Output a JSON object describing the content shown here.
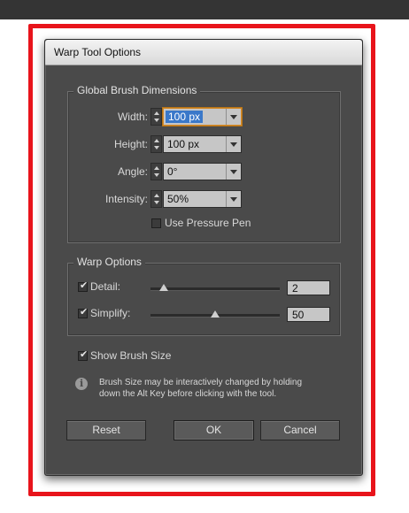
{
  "dialog": {
    "title": "Warp Tool Options"
  },
  "global_brush": {
    "legend": "Global Brush Dimensions",
    "fields": [
      {
        "label": "Width:",
        "value": "100 px",
        "focused": true
      },
      {
        "label": "Height:",
        "value": "100 px"
      },
      {
        "label": "Angle:",
        "value": "0°"
      },
      {
        "label": "Intensity:",
        "value": "50%"
      }
    ],
    "use_pressure_pen": {
      "label": "Use Pressure Pen",
      "checked": false
    }
  },
  "warp_options": {
    "legend": "Warp Options",
    "detail": {
      "label": "Detail:",
      "checked": true,
      "value": "2",
      "level": 0.1
    },
    "simplify": {
      "label": "Simplify:",
      "checked": true,
      "value": "50",
      "level": 0.5
    }
  },
  "show_brush_size": {
    "label": "Show Brush Size",
    "checked": true
  },
  "info": {
    "line1": "Brush Size may be interactively changed by holding",
    "line2": "down the Alt Key before clicking with the tool."
  },
  "buttons": {
    "reset": "Reset",
    "ok": "OK",
    "cancel": "Cancel"
  },
  "colors": {
    "dialog_bg": "#4a4a4a",
    "highlight_frame": "#e8141b",
    "selection": "#3a78c9",
    "focus_ring": "#d48a2a"
  }
}
